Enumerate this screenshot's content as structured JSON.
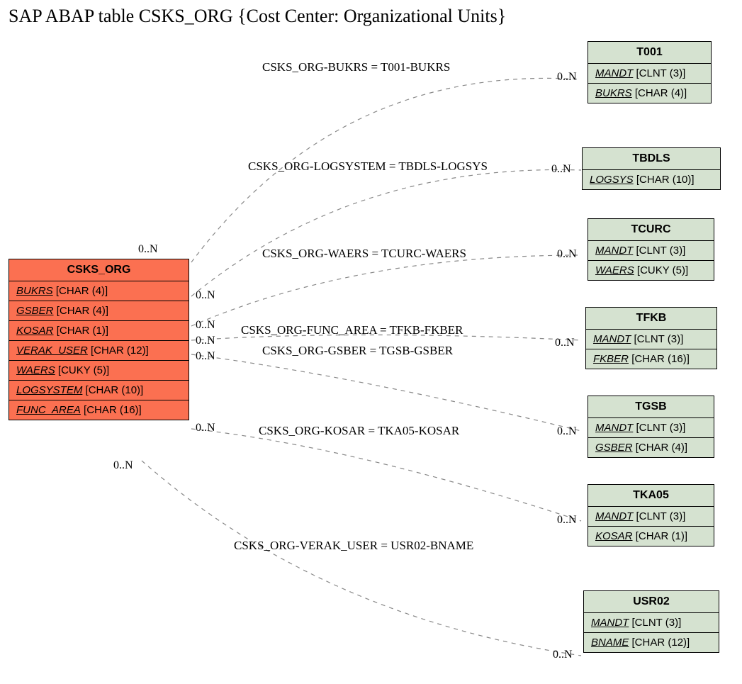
{
  "title": "SAP ABAP table CSKS_ORG {Cost Center: Organizational Units}",
  "main_entity": {
    "name": "CSKS_ORG",
    "fields": [
      {
        "name": "BUKRS",
        "type": "[CHAR (4)]"
      },
      {
        "name": "GSBER",
        "type": "[CHAR (4)]"
      },
      {
        "name": "KOSAR",
        "type": "[CHAR (1)]"
      },
      {
        "name": "VERAK_USER",
        "type": "[CHAR (12)]"
      },
      {
        "name": "WAERS",
        "type": "[CUKY (5)]"
      },
      {
        "name": "LOGSYSTEM",
        "type": "[CHAR (10)]"
      },
      {
        "name": "FUNC_AREA",
        "type": "[CHAR (16)]"
      }
    ]
  },
  "targets": [
    {
      "name": "T001",
      "fields": [
        {
          "name": "MANDT",
          "type": "[CLNT (3)]"
        },
        {
          "name": "BUKRS",
          "type": "[CHAR (4)]"
        }
      ]
    },
    {
      "name": "TBDLS",
      "fields": [
        {
          "name": "LOGSYS",
          "type": "[CHAR (10)]"
        }
      ]
    },
    {
      "name": "TCURC",
      "fields": [
        {
          "name": "MANDT",
          "type": "[CLNT (3)]"
        },
        {
          "name": "WAERS",
          "type": "[CUKY (5)]"
        }
      ]
    },
    {
      "name": "TFKB",
      "fields": [
        {
          "name": "MANDT",
          "type": "[CLNT (3)]"
        },
        {
          "name": "FKBER",
          "type": "[CHAR (16)]"
        }
      ]
    },
    {
      "name": "TGSB",
      "fields": [
        {
          "name": "MANDT",
          "type": "[CLNT (3)]"
        },
        {
          "name": "GSBER",
          "type": "[CHAR (4)]"
        }
      ]
    },
    {
      "name": "TKA05",
      "fields": [
        {
          "name": "MANDT",
          "type": "[CLNT (3)]"
        },
        {
          "name": "KOSAR",
          "type": "[CHAR (1)]"
        }
      ]
    },
    {
      "name": "USR02",
      "fields": [
        {
          "name": "MANDT",
          "type": "[CLNT (3)]"
        },
        {
          "name": "BNAME",
          "type": "[CHAR (12)]"
        }
      ]
    }
  ],
  "relations": [
    {
      "label": "CSKS_ORG-BUKRS = T001-BUKRS"
    },
    {
      "label": "CSKS_ORG-LOGSYSTEM = TBDLS-LOGSYS"
    },
    {
      "label": "CSKS_ORG-WAERS = TCURC-WAERS"
    },
    {
      "label": "CSKS_ORG-FUNC_AREA = TFKB-FKBER"
    },
    {
      "label": "CSKS_ORG-GSBER = TGSB-GSBER"
    },
    {
      "label": "CSKS_ORG-KOSAR = TKA05-KOSAR"
    },
    {
      "label": "CSKS_ORG-VERAK_USER = USR02-BNAME"
    }
  ],
  "cardinality": "0..N"
}
